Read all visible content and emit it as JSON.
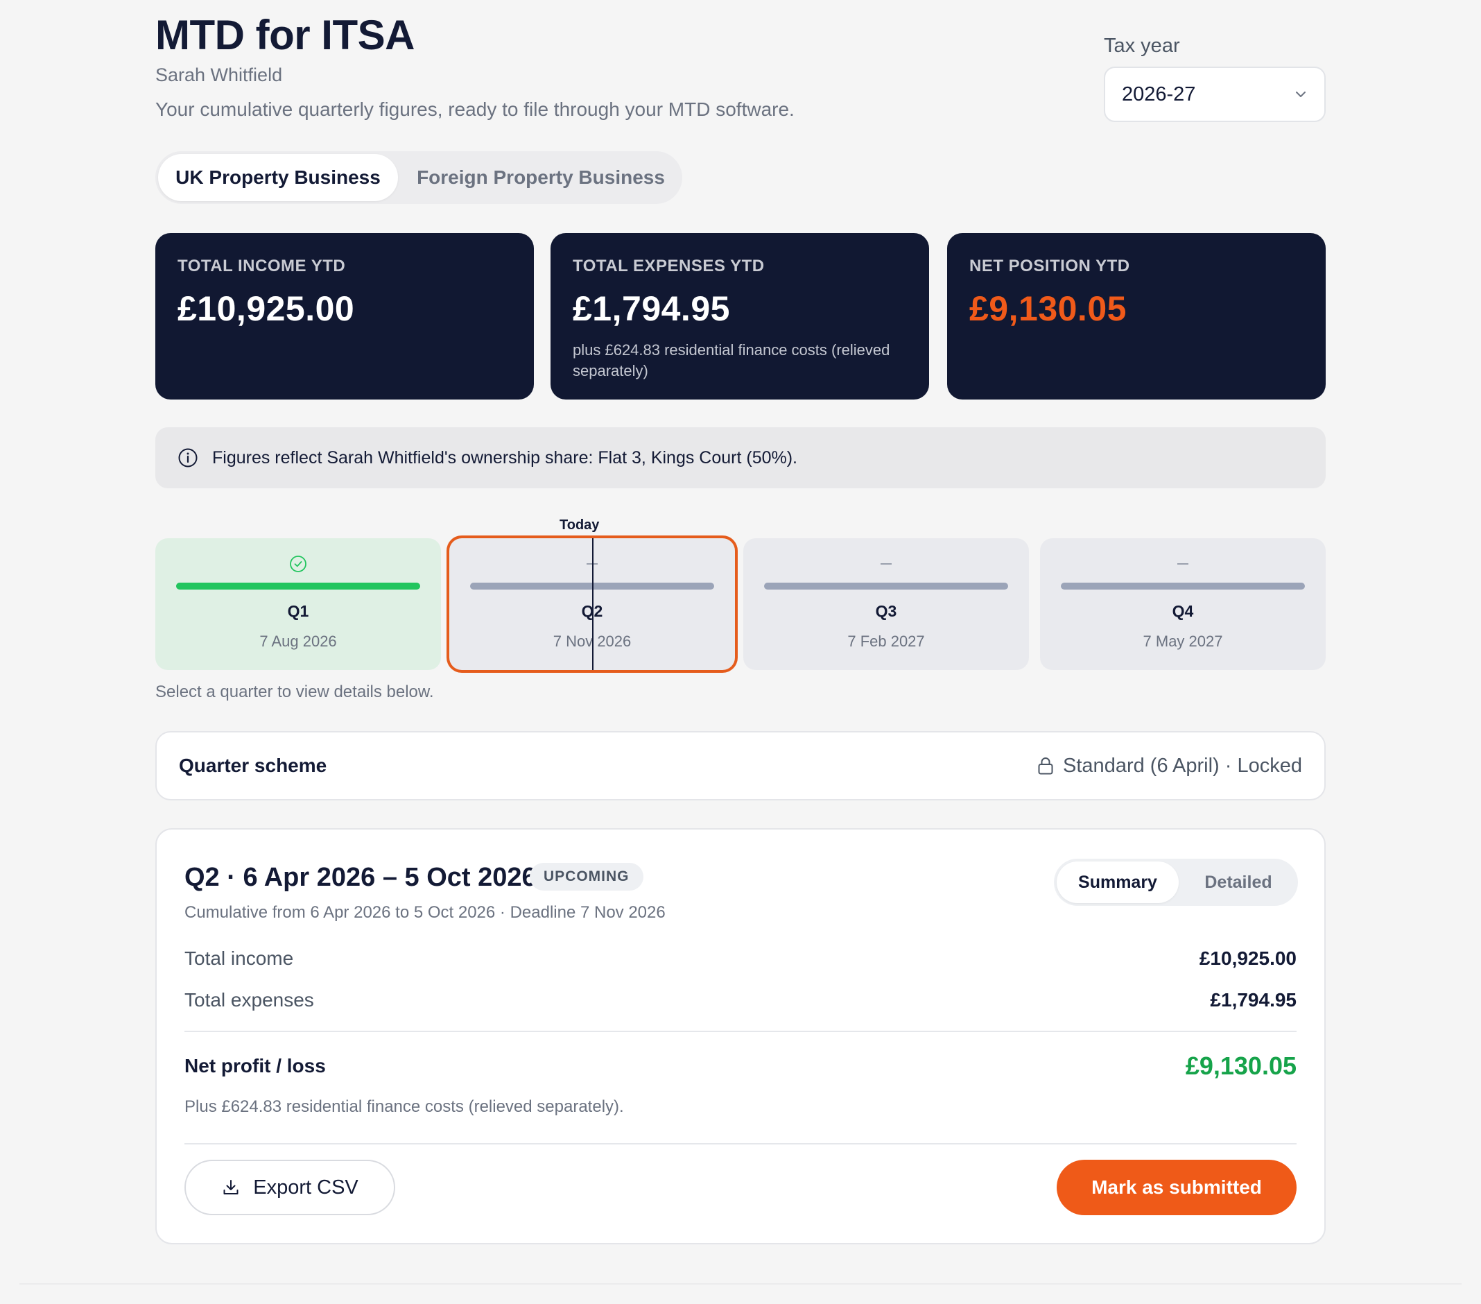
{
  "header": {
    "title": "MTD for ITSA",
    "user_name": "Sarah Whitfield",
    "subtitle": "Your cumulative quarterly figures, ready to file through your MTD software."
  },
  "tax_year": {
    "label": "Tax year",
    "selected": "2026-27"
  },
  "tabs": [
    {
      "label": "UK Property Business",
      "active": true
    },
    {
      "label": "Foreign Property Business",
      "active": false
    }
  ],
  "stats": {
    "income": {
      "label": "TOTAL INCOME YTD",
      "value": "£10,925.00"
    },
    "expenses": {
      "label": "TOTAL EXPENSES YTD",
      "value": "£1,794.95",
      "note": "plus £624.83 residential finance costs (relieved separately)"
    },
    "net": {
      "label": "NET POSITION YTD",
      "value": "£9,130.05"
    }
  },
  "info_banner": "Figures reflect Sarah Whitfield's ownership share: Flat 3, Kings Court (50%).",
  "timeline": {
    "today_label": "Today",
    "quarters": [
      {
        "name": "Q1",
        "deadline": "7 Aug 2026",
        "status": "submitted"
      },
      {
        "name": "Q2",
        "deadline": "7 Nov 2026",
        "status": "upcoming"
      },
      {
        "name": "Q3",
        "deadline": "7 Feb 2027",
        "status": "future"
      },
      {
        "name": "Q4",
        "deadline": "7 May 2027",
        "status": "future"
      }
    ],
    "hint": "Select a quarter to view details below."
  },
  "scheme": {
    "label": "Quarter scheme",
    "value": "Standard (6 April) · Locked"
  },
  "detail": {
    "title": "Q2 · 6 Apr 2026 – 5 Oct 2026",
    "badge": "UPCOMING",
    "subtitle": "Cumulative from 6 Apr 2026 to 5 Oct 2026 · Deadline 7 Nov 2026",
    "view_toggle": {
      "summary": "Summary",
      "detailed": "Detailed",
      "selected": "Summary"
    },
    "rows": {
      "income": {
        "label": "Total income",
        "value": "£10,925.00"
      },
      "expenses": {
        "label": "Total expenses",
        "value": "£1,794.95"
      },
      "net": {
        "label": "Net profit / loss",
        "value": "£9,130.05"
      }
    },
    "note": "Plus £624.83 residential finance costs (relieved separately).",
    "export_label": "Export CSV",
    "submit_label": "Mark as submitted"
  },
  "colors": {
    "accent": "#ef5a18",
    "navy": "#111832",
    "success": "#22c55e"
  }
}
